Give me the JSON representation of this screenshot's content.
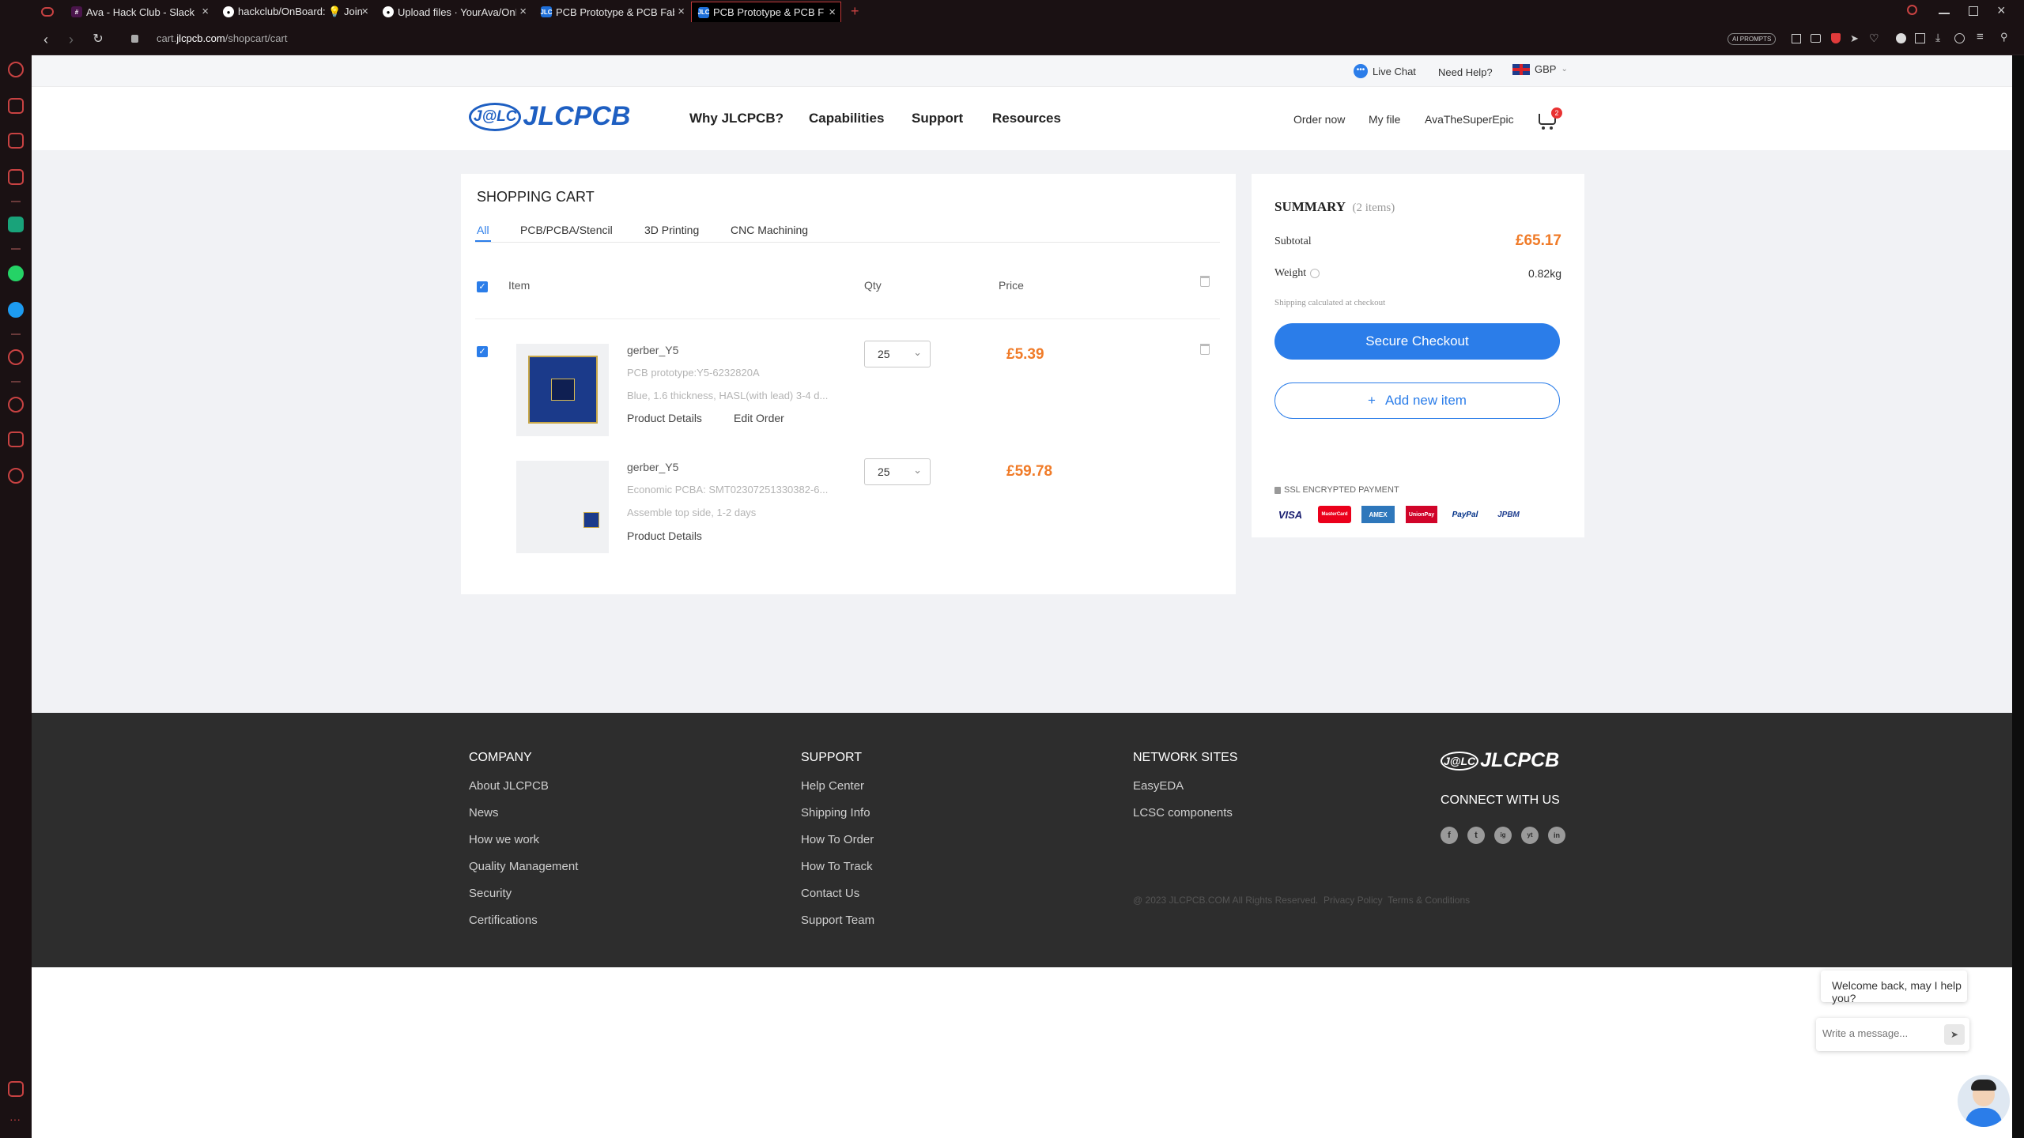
{
  "browser": {
    "tabs": [
      {
        "title": "Ava - Hack Club - Slack",
        "icon": "slack-icon"
      },
      {
        "title": "hackclub/OnBoard: 💡 Join",
        "icon": "github-icon"
      },
      {
        "title": "Upload files · YourAva/OnB",
        "icon": "github-icon"
      },
      {
        "title": "PCB Prototype & PCB Fabric",
        "icon": "jlc-icon"
      },
      {
        "title": "PCB Prototype & PCB Fabric",
        "icon": "jlc-icon"
      }
    ],
    "new_tab": "+",
    "url_prefix": "cart.",
    "url_domain": "jlcpcb.com",
    "url_path": "/shopcart/cart",
    "ai_prompts": "AI PROMPTS"
  },
  "topstrip": {
    "live_chat": "Live Chat",
    "need_help": "Need Help?",
    "currency": "GBP"
  },
  "header": {
    "logo_mark": "J@LC",
    "logo_text": "JLCPCB",
    "nav": [
      "Why JLCPCB?",
      "Capabilities",
      "Support",
      "Resources"
    ],
    "order_now": "Order now",
    "my_file": "My file",
    "username": "AvaTheSuperEpic",
    "cart_count": "2"
  },
  "cart": {
    "title": "SHOPPING CART",
    "tabs": [
      "All",
      "PCB/PCBA/Stencil",
      "3D Printing",
      "CNC Machining"
    ],
    "columns": {
      "item": "Item",
      "qty": "Qty",
      "price": "Price"
    },
    "items": [
      {
        "name": "gerber_Y5",
        "line1": "PCB prototype:Y5-6232820A",
        "line2": "Blue, 1.6 thickness, HASL(with lead) 3-4 d...",
        "link1": "Product Details",
        "link2": "Edit Order",
        "qty": "25",
        "price": "£5.39"
      },
      {
        "name": "gerber_Y5",
        "line1": "Economic PCBA: SMT02307251330382-6...",
        "line2": "Assemble top side, 1-2 days",
        "link1": "Product Details",
        "qty": "25",
        "price": "£59.78"
      }
    ]
  },
  "summary": {
    "title": "SUMMARY",
    "count": "(2 items)",
    "subtotal_label": "Subtotal",
    "subtotal": "£65.17",
    "weight_label": "Weight",
    "weight": "0.82kg",
    "shipping_note": "Shipping calculated at checkout",
    "checkout": "Secure Checkout",
    "add_item": "Add new item",
    "add_plus": "+",
    "payments": [
      "VISA",
      "MasterCard",
      "AMEX",
      "UnionPay",
      "PayPal",
      "JPBM"
    ],
    "ssl": "SSL ENCRYPTED PAYMENT"
  },
  "footer": {
    "company": {
      "title": "COMPANY",
      "links": [
        "About JLCPCB",
        "News",
        "How we work",
        "Quality Management",
        "Security",
        "Certifications"
      ]
    },
    "support": {
      "title": "SUPPORT",
      "links": [
        "Help Center",
        "Shipping Info",
        "How To Order",
        "How To Track",
        "Contact Us",
        "Support Team"
      ]
    },
    "network": {
      "title": "NETWORK SITES",
      "links": [
        "EasyEDA",
        "LCSC components"
      ]
    },
    "connect": "CONNECT WITH US",
    "copyright": "@ 2023 JLCPCB.COM All Rights Reserved.  Privacy Policy  Terms & Conditions",
    "socials": [
      "f",
      "t",
      "ig",
      "yt",
      "in"
    ]
  },
  "chat": {
    "greeting": "Welcome back, may I help you?",
    "placeholder": "Write a message..."
  },
  "colors": {
    "accent": "#2b7de9",
    "price": "#f07b28",
    "footer_bg": "#2d2d2d",
    "logo_blue": "#1e5fc2"
  }
}
